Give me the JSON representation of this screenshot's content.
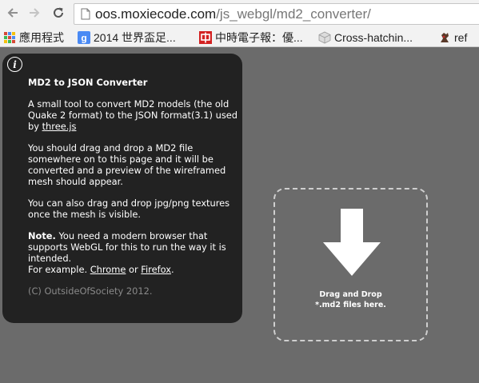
{
  "browser": {
    "url_host": "oos.moxiecode.com",
    "url_path": "/js_webgl/md2_converter/",
    "bookmarks": [
      {
        "label": "應用程式",
        "icon": "apps-grid-icon"
      },
      {
        "label": "2014 世界盃足...",
        "icon": "google-icon"
      },
      {
        "label": "中時電子報：優...",
        "icon": "chinatimes-icon"
      },
      {
        "label": "Cross-hatchin...",
        "icon": "cube-icon"
      },
      {
        "label": "ref",
        "icon": "ref-icon"
      }
    ]
  },
  "info": {
    "icon_glyph": "i",
    "title": "MD2 to JSON Converter",
    "p1_text": "A small tool to convert MD2 models (the old Quake 2 format) to the JSON format(3.1) used by ",
    "p1_link": "three.js",
    "p2": "You should drag and drop a MD2 file somewhere on to this page and it will be converted and a preview of the wireframed mesh should appear.",
    "p3": "You can also drag and drop jpg/png textures once the mesh is visible.",
    "note_label": "Note.",
    "note_text": " You need a modern browser that supports WebGL for this to run the way it is intended.",
    "example_prefix": "For example. ",
    "chrome_link": "Chrome",
    "or_text": " or ",
    "firefox_link": "Firefox",
    "period": ".",
    "copyright": "(C) OutsideOfSociety 2012."
  },
  "drop": {
    "line1": "Drag and Drop",
    "line2": "*.md2 files here."
  },
  "colors": {
    "page_bg": "#6b6b6b",
    "panel_bg": "#222222",
    "text": "#ffffff",
    "muted_text": "#8a8a8a",
    "dash_border": "#cfcfcf"
  }
}
